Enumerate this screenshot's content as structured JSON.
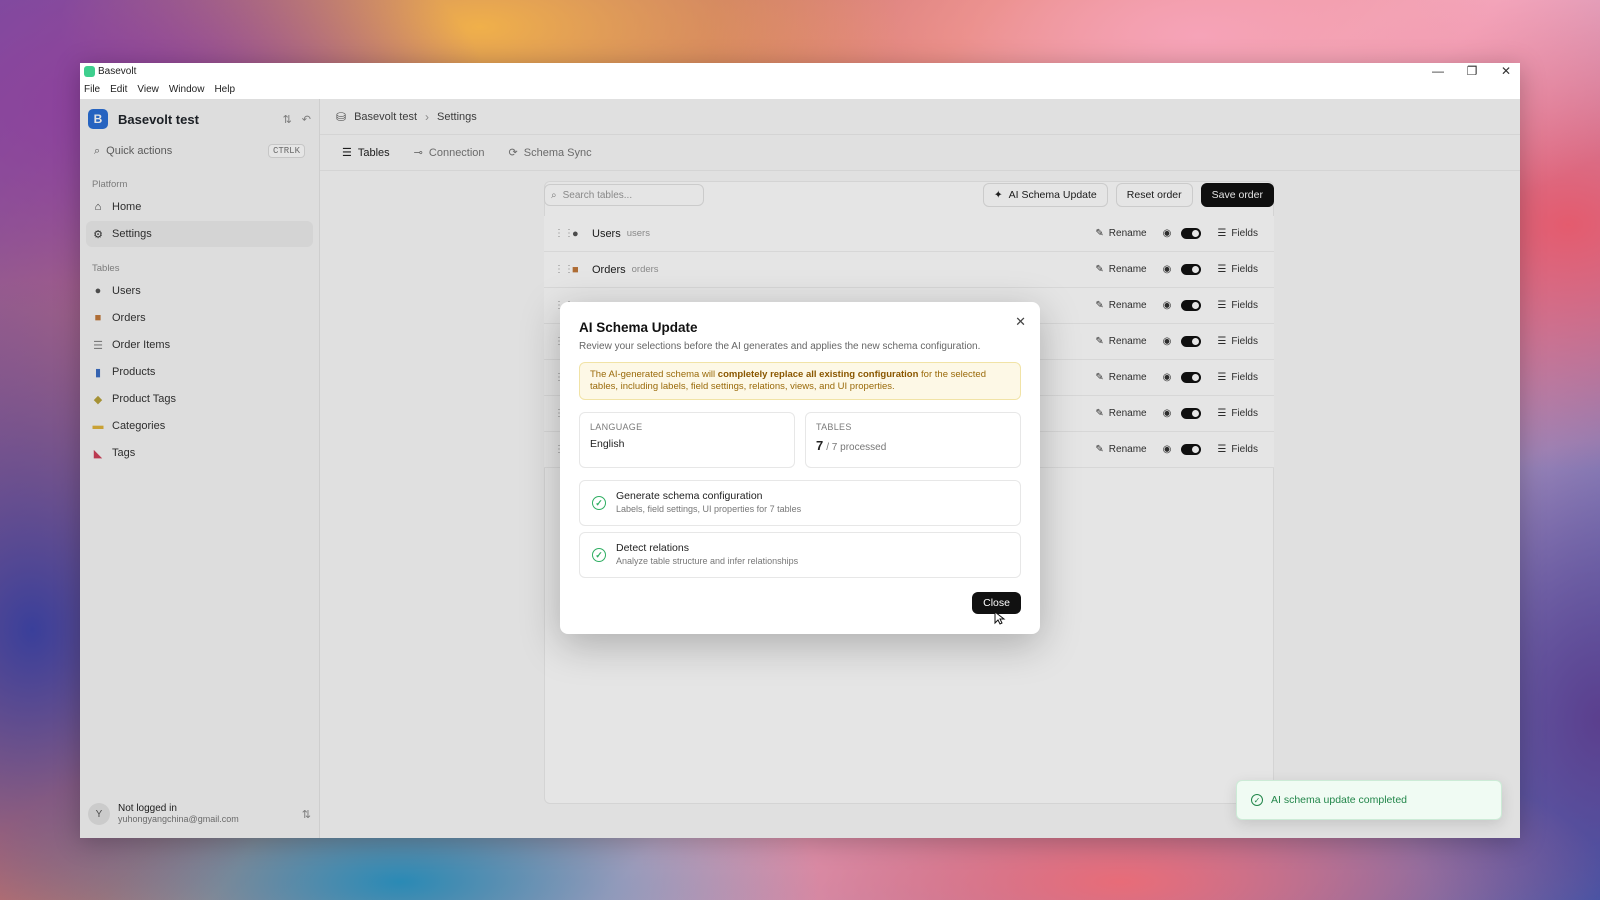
{
  "window": {
    "title": "Basevolt",
    "controls": {
      "minimize": "—",
      "restore": "❐",
      "close": "✕"
    }
  },
  "menu": [
    "File",
    "Edit",
    "View",
    "Window",
    "Help"
  ],
  "sidebar": {
    "workspace_badge": "B",
    "workspace_name": "Basevolt test",
    "quick_actions": "Quick actions",
    "quick_shortcut": "CTRLK",
    "platform_label": "Platform",
    "platform_items": [
      {
        "label": "Home",
        "icon": "home-icon"
      },
      {
        "label": "Settings",
        "icon": "gear-icon"
      }
    ],
    "tables_label": "Tables",
    "table_items": [
      {
        "label": "Users",
        "icon": "user-icon"
      },
      {
        "label": "Orders",
        "icon": "package-icon"
      },
      {
        "label": "Order Items",
        "icon": "list-icon"
      },
      {
        "label": "Products",
        "icon": "product-icon"
      },
      {
        "label": "Product Tags",
        "icon": "tag-icon"
      },
      {
        "label": "Categories",
        "icon": "folder-icon"
      },
      {
        "label": "Tags",
        "icon": "pin-icon"
      }
    ],
    "user_initial": "Y",
    "user_name": "Not logged in",
    "user_email": "yuhongyangchina@gmail.com"
  },
  "breadcrumb": {
    "root": "Basevolt test",
    "current": "Settings"
  },
  "tabs": [
    {
      "label": "Tables",
      "icon": "table-icon",
      "active": true
    },
    {
      "label": "Connection",
      "icon": "connection-icon",
      "active": false
    },
    {
      "label": "Schema Sync",
      "icon": "sync-icon",
      "active": false
    }
  ],
  "toolbar": {
    "search_placeholder": "Search tables...",
    "ai_button": "AI Schema Update",
    "reset_button": "Reset order",
    "save_button": "Save order"
  },
  "rows": [
    {
      "label": "Users",
      "sub": "users",
      "icon": "user-icon"
    },
    {
      "label": "Orders",
      "sub": "orders",
      "icon": "package-icon"
    },
    {
      "label": "",
      "sub": "",
      "icon": ""
    },
    {
      "label": "",
      "sub": "",
      "icon": ""
    },
    {
      "label": "",
      "sub": "",
      "icon": ""
    },
    {
      "label": "",
      "sub": "",
      "icon": ""
    },
    {
      "label": "",
      "sub": "",
      "icon": ""
    }
  ],
  "row_actions": {
    "rename": "Rename",
    "fields": "Fields"
  },
  "modal": {
    "title": "AI Schema Update",
    "description": "Review your selections before the AI generates and applies the new schema configuration.",
    "warning_pre": "The AI-generated schema will ",
    "warning_bold": "completely replace all existing configuration",
    "warning_post": " for the selected tables, including labels, field settings, relations, views, and UI properties.",
    "language_label": "LANGUAGE",
    "language_value": "English",
    "tables_label": "TABLES",
    "tables_count": "7",
    "tables_rest": "/ 7 processed",
    "steps": [
      {
        "title": "Generate schema configuration",
        "sub": "Labels, field settings, UI properties for 7 tables"
      },
      {
        "title": "Detect relations",
        "sub": "Analyze table structure and infer relationships"
      }
    ],
    "close_button": "Close"
  },
  "toast": {
    "message": "AI schema update completed"
  },
  "colors": {
    "accent": "#111111",
    "success": "#22864a",
    "warning_bg": "#fdf8e6",
    "workspace": "#2b6fd6"
  }
}
